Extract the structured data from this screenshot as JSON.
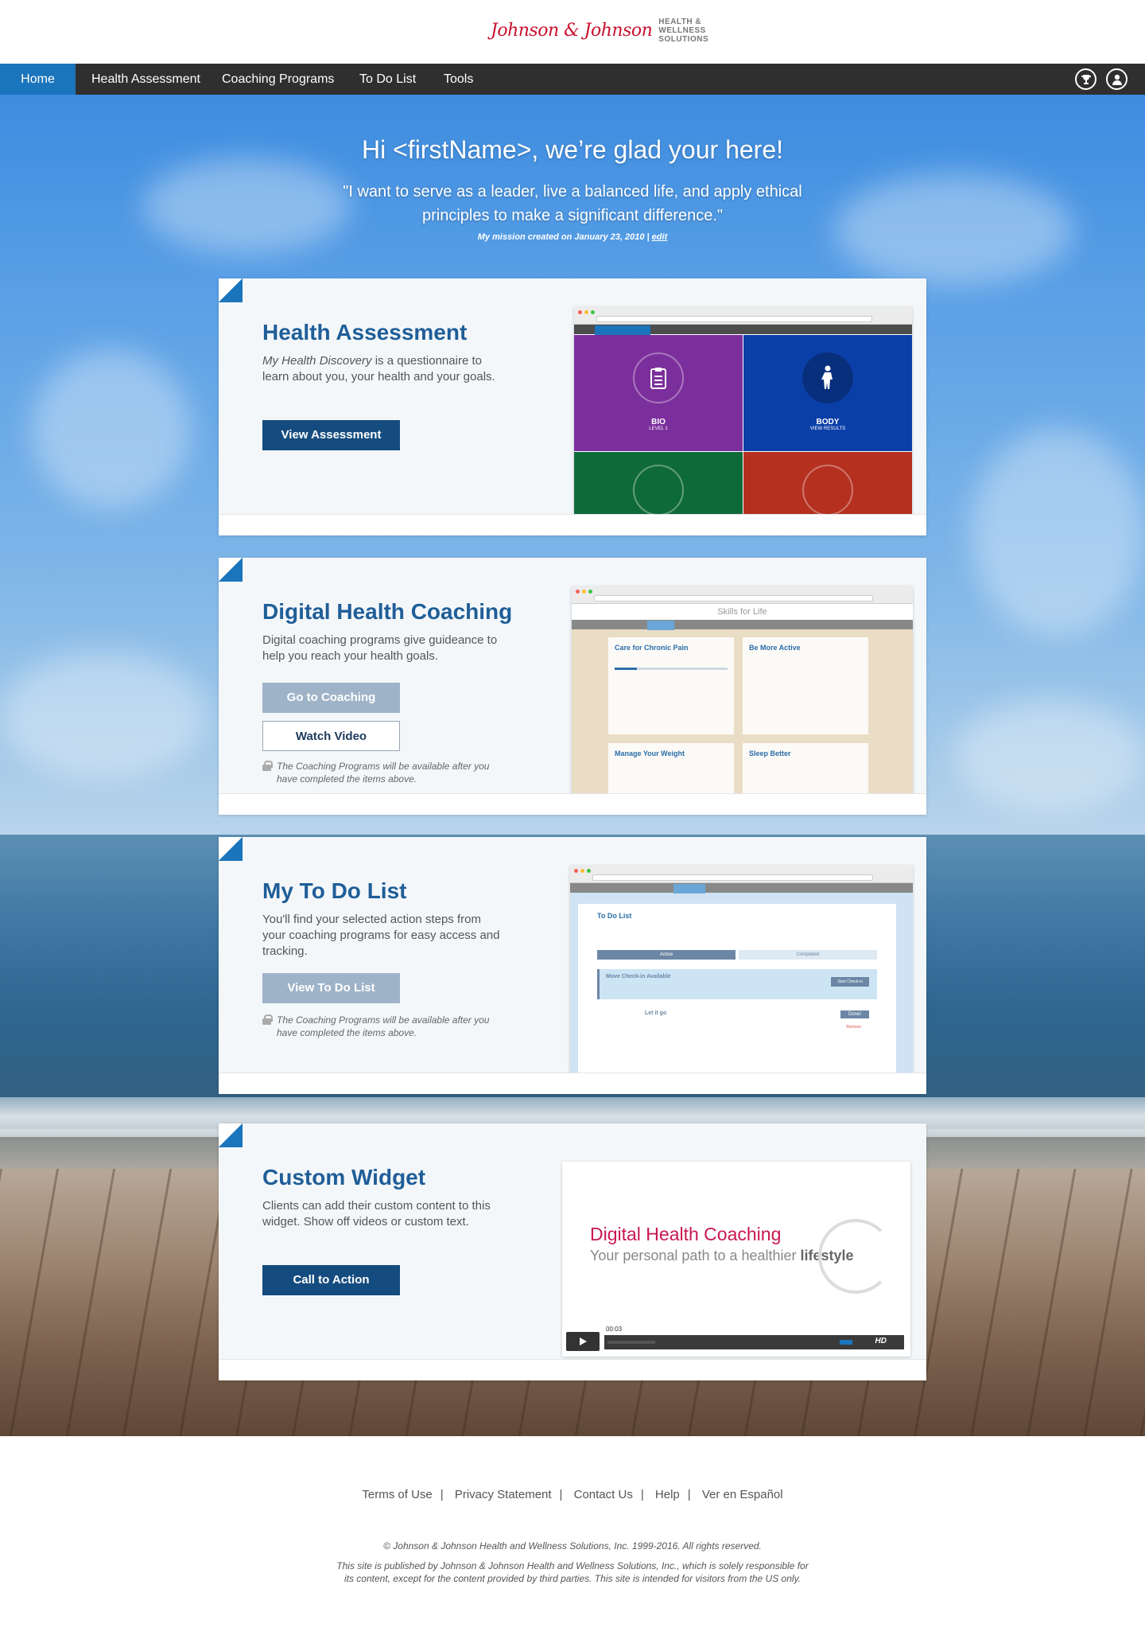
{
  "header": {
    "logo_script": "Johnson & Johnson",
    "logo_tagline": [
      "HEALTH &",
      "WELLNESS",
      "SOLUTIONS"
    ]
  },
  "nav": {
    "items": [
      {
        "label": "Home",
        "active": true
      },
      {
        "label": "Health Assessment"
      },
      {
        "label": "Coaching Programs"
      },
      {
        "label": "To Do List"
      },
      {
        "label": "Tools"
      }
    ],
    "icons": [
      "trophy-icon",
      "user-icon"
    ]
  },
  "hero": {
    "greeting": "Hi <firstName>, we’re glad your here!",
    "mission": "\"I want to serve as a leader, live a balanced life, and apply ethical principles to make a significant difference.\"",
    "mission_date": "My mission created on January 23, 2010 |",
    "edit_label": "edit"
  },
  "cards": [
    {
      "title": "Health Assessment",
      "desc_em": "My Health Discovery",
      "desc": " is a questionnaire to learn about you, your health and your goals.",
      "button": "View Assessment",
      "screenshot": {
        "tiles": [
          {
            "label": "BIO",
            "sub": "LEVEL 1",
            "color": "#7b2f9c"
          },
          {
            "label": "BODY",
            "sub": "VIEW RESULTS",
            "color": "#0b3fa8"
          },
          {
            "label": "",
            "color": "#0f6a3a"
          },
          {
            "label": "",
            "color": "#b5301f"
          }
        ]
      }
    },
    {
      "title": "Digital Health Coaching",
      "desc": "Digital coaching programs give guideance to help you reach your health goals.",
      "button": "Go to Coaching",
      "button2": "Watch Video",
      "note": "The Coaching Programs will be available after you have completed the items above.",
      "screenshot": {
        "header": "Skills for Life",
        "programs": [
          "Care for Chronic Pain",
          "Be More Active",
          "Manage Your Weight",
          "Sleep Better"
        ]
      }
    },
    {
      "title": "My To Do List",
      "desc": "You'll find your selected action steps from your coaching programs for easy access and tracking.",
      "button": "View To Do List",
      "note": "The Coaching Programs will be available after you have completed the items above.",
      "screenshot": {
        "heading": "To Do List",
        "tabs": [
          "Active",
          "Completed"
        ],
        "banner": "Move Check-in Available",
        "banner_btn": "Start Check-in",
        "item": "Let it go",
        "done": "Done!",
        "remove": "Remove"
      }
    },
    {
      "title": "Custom Widget",
      "desc": "Clients can add their custom content to this widget.  Show off videos or custom text.",
      "button": "Call to Action",
      "video": {
        "title": "Digital Health Coaching",
        "subtitle_pre": "Your personal path to a healthier ",
        "subtitle_bold": "lifestyle",
        "time": "00:03",
        "hd": "HD"
      }
    }
  ],
  "footer": {
    "links": [
      "Terms of Use",
      "Privacy Statement",
      "Contact Us",
      "Help",
      "Ver en Español"
    ],
    "copyright": "© Johnson & Johnson Health and Wellness Solutions, Inc. 1999-2016. All rights reserved.",
    "disclaimer": "This site is published by Johnson & Johnson Health and Wellness Solutions, Inc., which is solely responsible for its content, except for the content provided by third parties.  This site is intended for visitors from the US only."
  },
  "colors": {
    "nav_bg": "#2f2f2f",
    "nav_active": "#1b75bc",
    "title_blue": "#1f5e98",
    "primary_btn": "#154c7f",
    "disabled_btn": "#9fb3c8",
    "brand_red": "#c8102e"
  }
}
